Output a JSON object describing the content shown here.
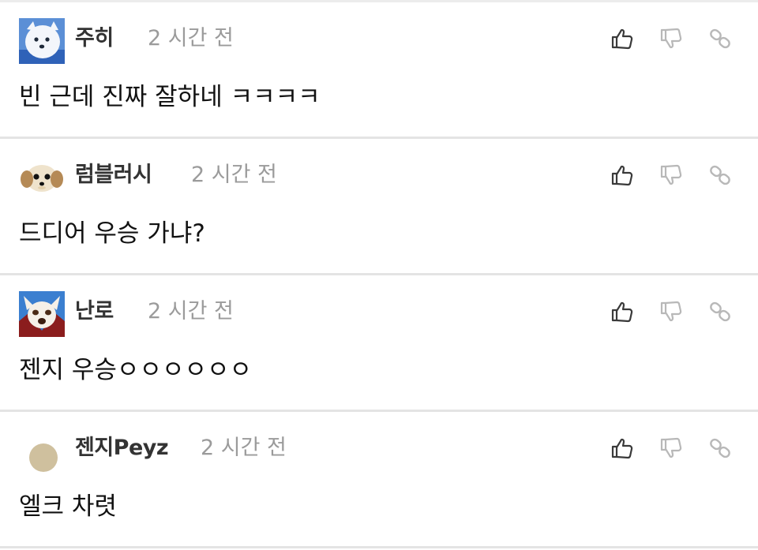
{
  "comments": [
    {
      "author": "주히",
      "time": "2 시간 전",
      "text": "빈 근데 진짜 잘하네 ㅋㅋㅋㅋ",
      "avatar": "white-dog-icon"
    },
    {
      "author": "럼블러시",
      "time": "2 시간 전",
      "text": "드디어 우승 가냐?",
      "avatar": "puppy-icon"
    },
    {
      "author": "난로",
      "time": "2 시간 전",
      "text": "젠지 우승ㅇㅇㅇㅇㅇㅇ",
      "avatar": "fox-dog-icon"
    },
    {
      "author": "젠지Peyz",
      "time": "2 시간 전",
      "text": "엘크 차렷",
      "avatar": "beige-circle-icon"
    }
  ],
  "actions": {
    "like_icon": "thumbs-up-icon",
    "dislike_icon": "thumbs-down-icon",
    "link_icon": "link-icon"
  },
  "colors": {
    "author": "#333333",
    "time": "#9b9b9b",
    "text": "#111111",
    "divider": "#e4e4e4",
    "icon": "#3a3a3a",
    "icon_muted": "#b8b8b8"
  }
}
